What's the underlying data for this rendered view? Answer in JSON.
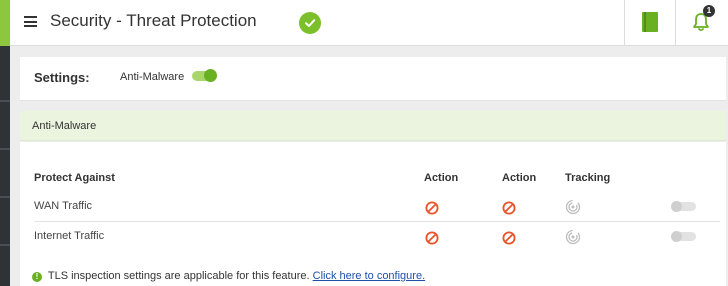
{
  "header": {
    "title": "Security - Threat Protection",
    "notification_count": "1",
    "status_icon": "check-circle-icon"
  },
  "settings": {
    "label": "Settings:",
    "toggle_label": "Anti-Malware",
    "toggle_state": "on"
  },
  "section": {
    "title": "Anti-Malware",
    "columns": [
      "Protect Against",
      "Action",
      "Action",
      "Tracking"
    ],
    "rows": [
      {
        "label": "WAN Traffic",
        "action1": "block-icon",
        "action2": "block-icon",
        "tracking": "fingerprint-icon",
        "enabled": "off"
      },
      {
        "label": "Internet Traffic",
        "action1": "block-icon",
        "action2": "block-icon",
        "tracking": "fingerprint-icon",
        "enabled": "off"
      }
    ],
    "note_text": "TLS inspection settings are applicable for this feature.",
    "note_link": "Click here to configure."
  },
  "colors": {
    "accent": "#8dc63f",
    "status_green": "#7bbf2a",
    "block_red": "#e8532a",
    "section_bg": "#eaf4df",
    "link": "#1f4fa8"
  }
}
